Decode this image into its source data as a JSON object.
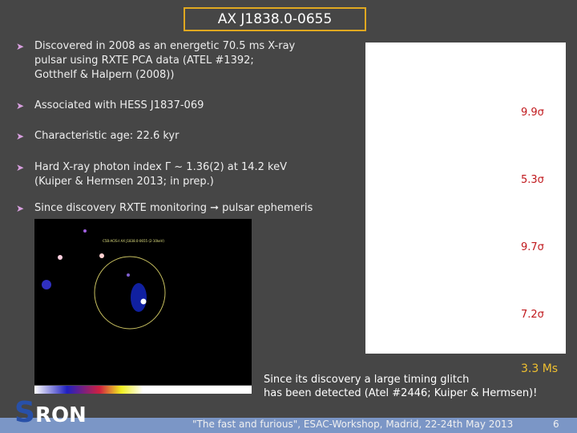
{
  "title": "AX J1838.0-0655",
  "bullets": [
    {
      "lines": [
        "Discovered in 2008  as an energetic 70.5 ms X-ray",
        "pulsar using RXTE PCA data (ATEL #1392;",
        "Gotthelf  & Halpern (2008))"
      ]
    },
    {
      "lines": [
        "Associated with HESS J1837-069"
      ]
    },
    {
      "lines": [
        "Characteristic age: 22.6 kyr"
      ]
    },
    {
      "lines": [
        "Hard X-ray photon index Γ ~ 1.36(2) at 14.2 keV",
        "(Kuiper & Hermsen 2013; in prep.)"
      ]
    },
    {
      "lines": [
        " Since discovery RXTE monitoring ➞ pulsar ephemeris"
      ]
    }
  ],
  "significances": [
    "9.9σ",
    "5.3σ",
    "9.7σ",
    "7.2σ"
  ],
  "image_label": "C5B-ACIS-I AX J1838.0-0655 (2-10keV)",
  "exposure": "3.3 Ms",
  "glitch": [
    "Since its discovery a large timing glitch",
    "has been detected (Atel #2446; Kuiper & Hermsen)!"
  ],
  "footer": "\"The fast and furious\",  ESAC-Workshop, Madrid, 22-24th May 2013",
  "page": "6",
  "logo": "SRON"
}
